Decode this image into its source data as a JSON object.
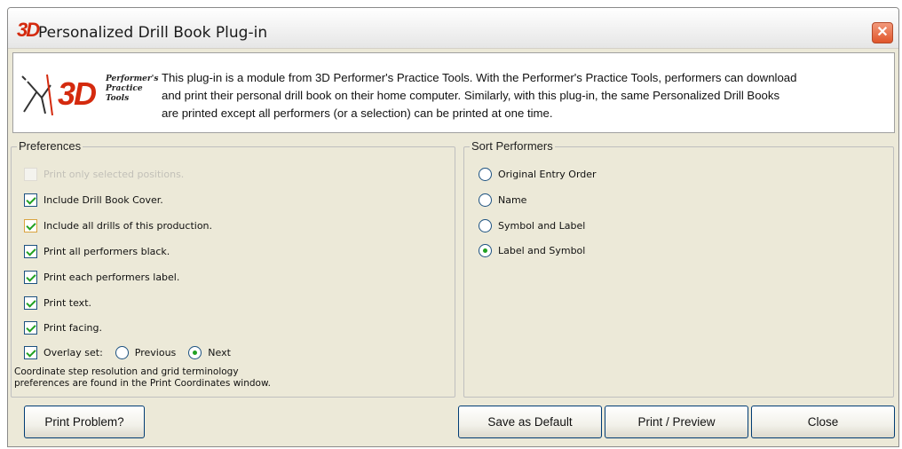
{
  "window": {
    "title": "Personalized Drill Book Plug-in",
    "title_logo": "3D",
    "close_glyph": "✕"
  },
  "info": {
    "logo_text": "3D",
    "logo_sub": [
      "Performer's",
      "Practice",
      "Tools"
    ],
    "lines": [
      "This plug-in is a module from 3D Performer's Practice Tools. With the Performer's Practice Tools, performers can download",
      "and print their personal drill book on their home computer.  Similarly, with this plug-in, the same Personalized Drill Books",
      "are printed except all performers (or a selection) can be printed at one time."
    ]
  },
  "preferences": {
    "label": "Preferences",
    "items": [
      {
        "label": "Print only selected positions.",
        "checked": false,
        "disabled": true
      },
      {
        "label": "Include Drill Book Cover.",
        "checked": true
      },
      {
        "label": "Include all drills of this production.",
        "checked": true
      },
      {
        "label": "Print all performers black.",
        "checked": true
      },
      {
        "label": "Print each performers label.",
        "checked": true
      },
      {
        "label": "Print text.",
        "checked": true
      },
      {
        "label": "Print facing.",
        "checked": true
      }
    ],
    "overlay": {
      "label": "Overlay set:",
      "checked": true,
      "options": [
        {
          "label": "Previous",
          "selected": false
        },
        {
          "label": "Next",
          "selected": true
        }
      ]
    },
    "note_lines": [
      "Coordinate step resolution and grid terminology",
      "preferences are found in the Print Coordinates window."
    ]
  },
  "sort": {
    "label": "Sort Performers",
    "options": [
      {
        "label": "Original Entry Order",
        "selected": false
      },
      {
        "label": "Name",
        "selected": false
      },
      {
        "label": "Symbol and Label",
        "selected": false
      },
      {
        "label": "Label and Symbol",
        "selected": true
      }
    ]
  },
  "buttons": {
    "print_problem": "Print Problem?",
    "save_default": "Save as Default",
    "print_preview": "Print / Preview",
    "close": "Close"
  },
  "colors": {
    "accent_red": "#d42a0e",
    "check_green": "#21a121",
    "border_blue": "#003c74"
  }
}
